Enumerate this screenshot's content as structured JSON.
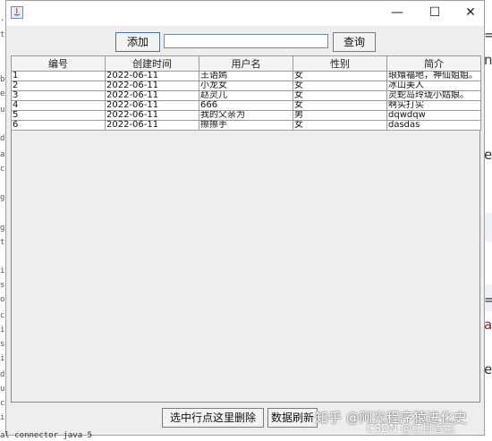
{
  "toolbar": {
    "add_label": "添加",
    "search_value": "",
    "query_label": "查询"
  },
  "table": {
    "columns": [
      "编号",
      "创建时间",
      "用户名",
      "性别",
      "简介"
    ],
    "rows": [
      [
        "1",
        "2022-06-11",
        "王语嫣",
        "女",
        "琅嬛福地，神仙姐姐。"
      ],
      [
        "2",
        "2022-06-11",
        "小龙女",
        "女",
        "冰山美人"
      ],
      [
        "3",
        "2022-06-11",
        "赵灵儿",
        "女",
        "灵蛇岛玲珑小姑娘。"
      ],
      [
        "4",
        "2022-06-11",
        "666",
        "女",
        "啊实打实"
      ],
      [
        "5",
        "2022-06-11",
        "我的父亲为",
        "男",
        "dqwdqw"
      ],
      [
        "6",
        "2022-06-11",
        "擦擦手",
        "女",
        "dasdas"
      ]
    ]
  },
  "footer": {
    "delete_label": "选中行点这里删除",
    "refresh_label": "数据刷新"
  },
  "window": {
    "minimize_glyph": "—",
    "maximize_glyph": "☐",
    "close_glyph": "✕"
  },
  "watermark": {
    "line1": "知乎 @阿光程序猿进化史",
    "line2": "CSDN @红目香薰"
  },
  "background": {
    "bottom_text": "al connector java 5",
    "right_glyphs": [
      "=",
      "n",
      "e",
      "=",
      "a",
      "e"
    ]
  },
  "colors": {
    "window_bg": "#eeeeee",
    "add_button_border": "#4a74b0"
  }
}
